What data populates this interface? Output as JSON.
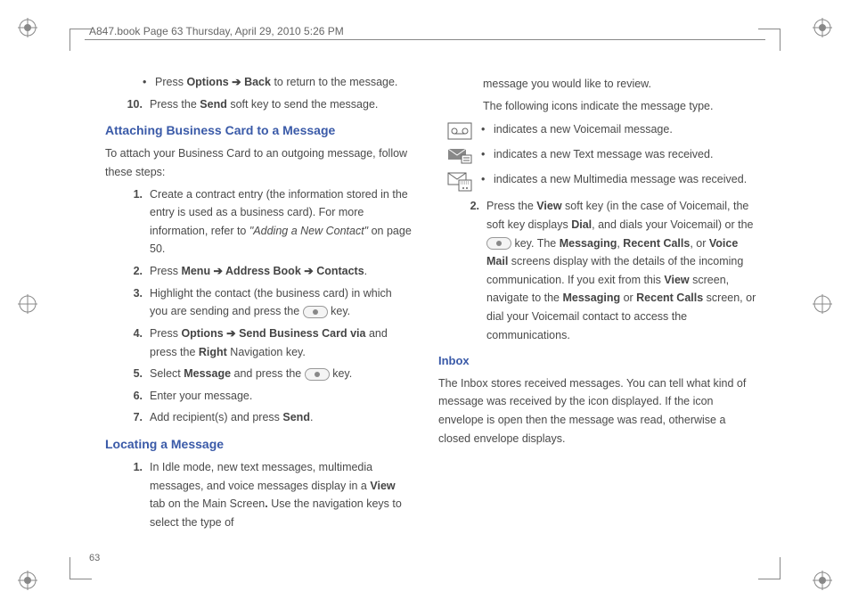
{
  "header": "A847.book  Page 63  Thursday, April 29, 2010  5:26 PM",
  "pagenum": "63",
  "left": {
    "bullet1_pre": "Press ",
    "bullet1_b1": "Options ➔ Back",
    "bullet1_post": " to return to the message.",
    "step10_num": "10.",
    "step10_a": "Press the ",
    "step10_b": "Send",
    "step10_c": " soft key to send the message.",
    "h1": "Attaching Business Card to a Message",
    "p1": "To attach your Business Card to an outgoing message, follow these steps:",
    "s1n": "1.",
    "s1a": "Create a contract entry (the information stored in the entry is used as a business card). For more information, refer to ",
    "s1i": "\"Adding a New Contact\"",
    "s1b": "  on page 50.",
    "s2n": "2.",
    "s2a": "Press ",
    "s2b": "Menu ➔ Address Book ➔ Contacts",
    "s2c": ".",
    "s3n": "3.",
    "s3a": "Highlight the contact (the business card) in which you are sending and press the ",
    "s3b": " key.",
    "s4n": "4.",
    "s4a": "Press ",
    "s4b": "Options ➔ Send Business Card via",
    "s4c": " and press the ",
    "s4d": "Right",
    "s4e": " Navigation key.",
    "s5n": "5.",
    "s5a": "Select ",
    "s5b": "Message",
    "s5c": " and press the ",
    "s5d": " key.",
    "s6n": "6.",
    "s6a": "Enter your message.",
    "s7n": "7.",
    "s7a": "Add recipient(s) and press ",
    "s7b": "Send",
    "s7c": ".",
    "h2": "Locating a Message",
    "l1n": "1.",
    "l1a": "In Idle mode, new text messages, multimedia messages, and voice messages display in a ",
    "l1b": "View",
    "l1c": " tab on the Main Screen",
    "l1dot": ". ",
    "l1d": "Use the navigation keys to select the type of"
  },
  "right": {
    "cont1": "message you would like to review.",
    "cont2": "The following icons indicate the message type.",
    "icon1": "indicates a new Voicemail message.",
    "icon2": "indicates a new Text message was received.",
    "icon3a": "indicates a new Multimedia message was received.",
    "s2n": "2.",
    "s2a": "Press the ",
    "s2b": "View",
    "s2c": " soft key (in the case of Voicemail, the soft key displays ",
    "s2d": "Dial",
    "s2e": ", and dials your Voicemail) or the ",
    "s2f": " key. The ",
    "s2g": "Messaging",
    "s2h": ", ",
    "s2i": "Recent Calls",
    "s2j": ", or ",
    "s2k": "Voice Mail",
    "s2l": " screens display with the details of the incoming communication. If you exit from this ",
    "s2m": "View",
    "s2n2": " screen, navigate to the ",
    "s2o": "Messaging",
    "s2p": " or ",
    "s2q": "Recent Calls",
    "s2r": " screen, or dial your Voicemail contact to access the communications.",
    "h3": "Inbox",
    "p3": "The Inbox stores received messages. You can tell what kind of message was received by the icon displayed. If the icon envelope is open then the message was read, otherwise a closed envelope displays."
  }
}
